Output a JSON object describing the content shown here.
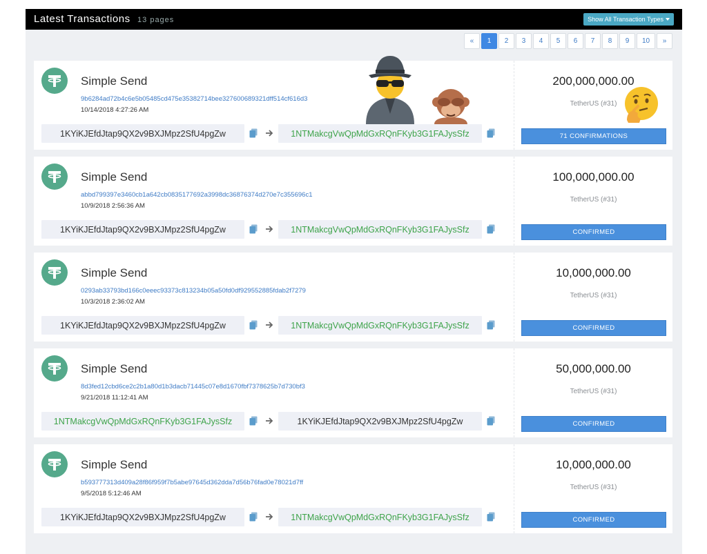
{
  "header": {
    "title": "Latest Transactions",
    "subtitle": "13 pages",
    "type_button": "Show All Transaction Types"
  },
  "pagination": [
    "«",
    "1",
    "2",
    "3",
    "4",
    "5",
    "6",
    "7",
    "8",
    "9",
    "10",
    "»"
  ],
  "active_page": "1",
  "transactions": [
    {
      "type": "Simple Send",
      "hash": "9b6284ad72b4c6e5b05485cd475e35382714bee327600689321dff514cf616d3",
      "time": "10/14/2018 4:27:26 AM",
      "from": "1KYiKJEfdJtap9QX2v9BXJMpz2SfU4pgZw",
      "to": "1NTMakcgVwQpMdGxRQnFKyb3G1FAJysSfz",
      "amount": "200,000,000.00",
      "asset": "TetherUS (#31)",
      "status": "71 CONFIRMATIONS"
    },
    {
      "type": "Simple Send",
      "hash": "abbd799397e3460cb1a642cb0835177692a3998dc36876374d270e7c355696c1",
      "time": "10/9/2018 2:56:36 AM",
      "from": "1KYiKJEfdJtap9QX2v9BXJMpz2SfU4pgZw",
      "to": "1NTMakcgVwQpMdGxRQnFKyb3G1FAJysSfz",
      "amount": "100,000,000.00",
      "asset": "TetherUS (#31)",
      "status": "CONFIRMED"
    },
    {
      "type": "Simple Send",
      "hash": "0293ab33793bd166c0eeec93373c813234b05a50fd0df929552885fdab2f7279",
      "time": "10/3/2018 2:36:02 AM",
      "from": "1KYiKJEfdJtap9QX2v9BXJMpz2SfU4pgZw",
      "to": "1NTMakcgVwQpMdGxRQnFKyb3G1FAJysSfz",
      "amount": "10,000,000.00",
      "asset": "TetherUS (#31)",
      "status": "CONFIRMED"
    },
    {
      "type": "Simple Send",
      "hash": "8d3fed12cbd6ce2c2b1a80d1b3dacb71445c07e8d1670fbf7378625b7d730bf3",
      "time": "9/21/2018 11:12:41 AM",
      "from": "1NTMakcgVwQpMdGxRQnFKyb3G1FAJysSfz",
      "to": "1KYiKJEfdJtap9QX2v9BXJMpz2SfU4pgZw",
      "amount": "50,000,000.00",
      "asset": "TetherUS (#31)",
      "status": "CONFIRMED"
    },
    {
      "type": "Simple Send",
      "hash": "b593777313d409a28f86f959f7b5abe97645d362dda7d56b76fad0e78021d7ff",
      "time": "9/5/2018 5:12:46 AM",
      "from": "1KYiKJEfdJtap9QX2v9BXJMpz2SfU4pgZw",
      "to": "1NTMakcgVwQpMdGxRQnFKyb3G1FAJysSfz",
      "amount": "10,000,000.00",
      "asset": "TetherUS (#31)",
      "status": "CONFIRMED"
    }
  ],
  "colors": {
    "header_bg": "#000000",
    "accent_blue": "#4a90dd",
    "tether_green": "#55a98b",
    "address_green": "#3ea34a",
    "link_blue": "#3e7bc5"
  },
  "icons": [
    "tether-logo-icon",
    "copy-icon",
    "arrow-right-icon",
    "spy-emoji-icon",
    "see-no-evil-monkey-emoji-icon",
    "thinking-face-emoji-icon"
  ]
}
